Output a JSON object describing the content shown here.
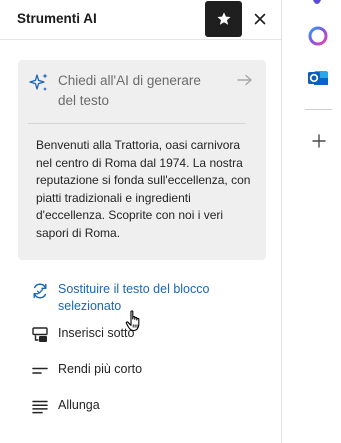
{
  "panel": {
    "title": "Strumenti AI",
    "pin_icon": "pin-star-icon",
    "close_icon": "close-icon"
  },
  "prompt_card": {
    "ask_label": "Chiedi all'AI di generare del testo",
    "body_text": "Benvenuti alla Trattoria, oasi carnivora nel centro di Roma dal 1974. La nostra reputazione si fonda sull'eccellenza, con piatti tradizionali e ingredienti d'eccellenza. Scoprite con noi i veri sapori di Roma."
  },
  "actions": [
    {
      "label": "Sostituire il testo del blocco selezionato",
      "icon": "replace-sync-icon",
      "active": true
    },
    {
      "label": "Inserisci sotto",
      "icon": "insert-below-icon",
      "active": false
    },
    {
      "label": "Rendi più corto",
      "icon": "shorten-icon",
      "active": false
    },
    {
      "label": "Allunga",
      "icon": "lengthen-icon",
      "active": false
    }
  ],
  "rail": {
    "icons": [
      "partial-app-icon",
      "copilot-icon",
      "outlook-icon",
      "add-icon"
    ]
  },
  "colors": {
    "accent": "#1b66b3",
    "card_bg": "#efefef",
    "pin_bg": "#1f1f1f"
  }
}
